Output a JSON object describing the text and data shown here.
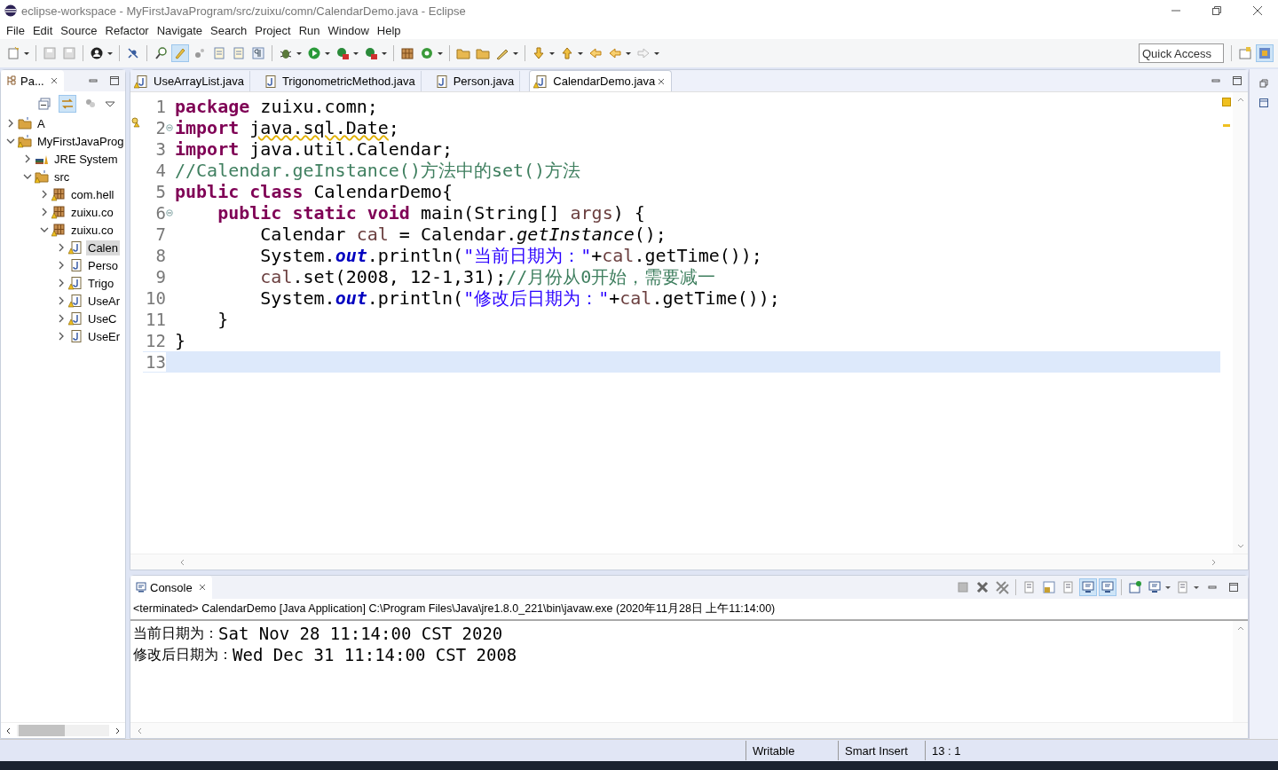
{
  "window": {
    "title": "eclipse-workspace - MyFirstJavaProgram/src/zuixu/comn/CalendarDemo.java - Eclipse"
  },
  "menu": [
    "File",
    "Edit",
    "Source",
    "Refactor",
    "Navigate",
    "Search",
    "Project",
    "Run",
    "Window",
    "Help"
  ],
  "quick_access": {
    "placeholder": "Quick Access"
  },
  "package_explorer": {
    "title": "Pa...",
    "tree": [
      {
        "label": "A",
        "kind": "project",
        "warning": false,
        "expanded": false,
        "selected": false
      },
      {
        "label": "MyFirstJavaProg",
        "kind": "project",
        "warning": true,
        "expanded": true,
        "selected": false,
        "children": [
          {
            "label": "JRE System",
            "kind": "library",
            "warning": false,
            "expanded": false,
            "selected": false
          },
          {
            "label": "src",
            "kind": "source-folder",
            "warning": true,
            "expanded": true,
            "selected": false,
            "children": [
              {
                "label": "com.hell",
                "kind": "package",
                "warning": true,
                "expanded": false,
                "selected": false
              },
              {
                "label": "zuixu.co",
                "kind": "package",
                "warning": true,
                "expanded": false,
                "selected": false
              },
              {
                "label": "zuixu.co",
                "kind": "package",
                "warning": true,
                "expanded": true,
                "selected": false,
                "children": [
                  {
                    "label": "Calen",
                    "kind": "java-file",
                    "warning": true,
                    "expanded": false,
                    "selected": true
                  },
                  {
                    "label": "Perso",
                    "kind": "java-file",
                    "warning": false,
                    "expanded": false,
                    "selected": false
                  },
                  {
                    "label": "Trigo",
                    "kind": "java-file",
                    "warning": true,
                    "expanded": false,
                    "selected": false
                  },
                  {
                    "label": "UseAr",
                    "kind": "java-file",
                    "warning": true,
                    "expanded": false,
                    "selected": false
                  },
                  {
                    "label": "UseC",
                    "kind": "java-file",
                    "warning": true,
                    "expanded": false,
                    "selected": false
                  },
                  {
                    "label": "UseEr",
                    "kind": "java-file",
                    "warning": false,
                    "expanded": false,
                    "selected": false
                  }
                ]
              }
            ]
          }
        ]
      }
    ]
  },
  "editor": {
    "tabs": [
      {
        "label": "UseArrayList.java",
        "selected": false,
        "warning": true
      },
      {
        "label": "TrigonometricMethod.java",
        "selected": false,
        "warning": false
      },
      {
        "label": "Person.java",
        "selected": false,
        "warning": false
      },
      {
        "label": "CalendarDemo.java",
        "selected": true,
        "warning": true
      }
    ],
    "lines": [
      {
        "number": "1",
        "current": false,
        "warning": false,
        "foldable": false,
        "tokens": [
          {
            "kind": "keyword",
            "text": "package"
          },
          {
            "kind": "plain",
            "text": " zuixu.comn;"
          }
        ]
      },
      {
        "number": "2",
        "current": false,
        "warning": true,
        "foldable": true,
        "tokens": [
          {
            "kind": "keyword",
            "text": "import "
          },
          {
            "kind": "squiggle",
            "text": "java.sql.Date"
          },
          {
            "kind": "plain",
            "text": ";"
          }
        ]
      },
      {
        "number": "3",
        "current": false,
        "warning": false,
        "foldable": false,
        "tokens": [
          {
            "kind": "keyword",
            "text": "import"
          },
          {
            "kind": "plain",
            "text": " java.util.Calendar;"
          }
        ]
      },
      {
        "number": "4",
        "current": false,
        "warning": false,
        "foldable": false,
        "tokens": [
          {
            "kind": "comment",
            "text": "//Calendar.geInstance()方法中的set()方法"
          }
        ]
      },
      {
        "number": "5",
        "current": false,
        "warning": false,
        "foldable": false,
        "tokens": [
          {
            "kind": "keyword",
            "text": "public "
          },
          {
            "kind": "keyword",
            "text": "class"
          },
          {
            "kind": "plain",
            "text": " CalendarDemo{"
          }
        ]
      },
      {
        "number": "6",
        "current": false,
        "warning": false,
        "foldable": true,
        "tokens": [
          {
            "kind": "keyword",
            "text": "    public static void"
          },
          {
            "kind": "plain",
            "text": " main(String[] "
          },
          {
            "kind": "variable",
            "text": "args"
          },
          {
            "kind": "plain",
            "text": ") {"
          }
        ]
      },
      {
        "number": "7",
        "current": false,
        "warning": false,
        "foldable": false,
        "tokens": [
          {
            "kind": "plain",
            "text": "        Calendar "
          },
          {
            "kind": "variable",
            "text": "cal"
          },
          {
            "kind": "plain",
            "text": " = Calendar."
          },
          {
            "kind": "italic",
            "text": "getInstance"
          },
          {
            "kind": "plain",
            "text": "();"
          }
        ]
      },
      {
        "number": "8",
        "current": false,
        "warning": false,
        "foldable": false,
        "tokens": [
          {
            "kind": "plain",
            "text": "        System."
          },
          {
            "kind": "static-field",
            "text": "out"
          },
          {
            "kind": "plain",
            "text": ".println("
          },
          {
            "kind": "string",
            "text": "\"当前日期为：\""
          },
          {
            "kind": "plain",
            "text": "+"
          },
          {
            "kind": "variable",
            "text": "cal"
          },
          {
            "kind": "plain",
            "text": ".getTime());"
          }
        ]
      },
      {
        "number": "9",
        "current": false,
        "warning": false,
        "foldable": false,
        "tokens": [
          {
            "kind": "variable",
            "text": "        cal"
          },
          {
            "kind": "plain",
            "text": ".set(2008, 12-1,31);"
          },
          {
            "kind": "comment",
            "text": "//月份从0开始，需要减一"
          }
        ]
      },
      {
        "number": "10",
        "current": false,
        "warning": false,
        "foldable": false,
        "tokens": [
          {
            "kind": "plain",
            "text": "        System."
          },
          {
            "kind": "static-field",
            "text": "out"
          },
          {
            "kind": "plain",
            "text": ".println("
          },
          {
            "kind": "string",
            "text": "\"修改后日期为：\""
          },
          {
            "kind": "plain",
            "text": "+"
          },
          {
            "kind": "variable",
            "text": "cal"
          },
          {
            "kind": "plain",
            "text": ".getTime());"
          }
        ]
      },
      {
        "number": "11",
        "current": false,
        "warning": false,
        "foldable": false,
        "tokens": [
          {
            "kind": "plain",
            "text": "    }"
          }
        ]
      },
      {
        "number": "12",
        "current": false,
        "warning": false,
        "foldable": false,
        "tokens": [
          {
            "kind": "plain",
            "text": "}"
          }
        ]
      },
      {
        "number": "13",
        "current": true,
        "warning": false,
        "foldable": false
      }
    ]
  },
  "console": {
    "title": "Console",
    "header": "<terminated> CalendarDemo [Java Application] C:\\Program Files\\Java\\jre1.8.0_221\\bin\\javaw.exe (2020年11月28日 上午11:14:00)",
    "output": [
      {
        "prefix": "当前日期为：",
        "text": "Sat Nov 28 11:14:00 CST 2020"
      },
      {
        "prefix": "修改后日期为：",
        "text": "Wed Dec 31 11:14:00 CST 2008"
      }
    ]
  },
  "status_bar": [
    "Writable",
    "Smart Insert",
    "13 : 1"
  ]
}
